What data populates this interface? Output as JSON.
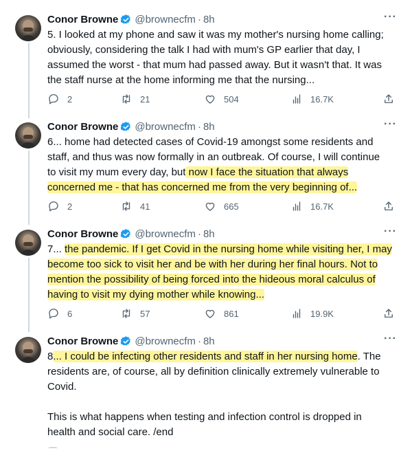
{
  "colors": {
    "text": "#0f1419",
    "secondary": "#536471",
    "verified": "#1d9bf0",
    "highlight": "#fff59a",
    "thread_line": "#cfd9de"
  },
  "icons": {
    "reply": "speech-bubble",
    "retweet": "loop-arrows",
    "like": "heart",
    "views": "bar-chart",
    "share": "upload-arrow",
    "more": "ellipsis",
    "verified": "blue-check-badge"
  },
  "tweets": [
    {
      "author": "Conor Browne",
      "handle": "@brownecfm",
      "separator": "·",
      "time": "8h",
      "more": "···",
      "text_lines": [
        "5. I looked at my phone and saw it was my mother's nursing home calling;",
        "obviously, considering the talk I had with mum's GP earlier that day, I",
        "assumed the worst - that mum had passed away. But it wasn't that. It was",
        "the staff nurse at the home informing me that the nursing..."
      ],
      "replies": "2",
      "retweets": "21",
      "likes": "504",
      "views": "16.7K"
    },
    {
      "author": "Conor Browne",
      "handle": "@brownecfm",
      "separator": "·",
      "time": "8h",
      "more": "···",
      "text_plain_1": "6... home had detected cases of Covid-19 amongst some residents and",
      "text_plain_2": "staff, and thus was now formally in an outbreak. Of course, I will continue",
      "text_plain_3": "to visit my mum every day, but",
      "text_hl_3": " now I face the situation that always",
      "text_hl_4": "concerned me - that has concerned me from the very beginning of...",
      "replies": "2",
      "retweets": "41",
      "likes": "665",
      "views": "16.7K"
    },
    {
      "author": "Conor Browne",
      "handle": "@brownecfm",
      "separator": "·",
      "time": "8h",
      "more": "···",
      "text_plain_1": "7... ",
      "text_hl_1": "the pandemic. If I get Covid in the nursing home while visiting her, I may",
      "text_hl_2": "become too sick to visit her and be with her during her final hours. Not to",
      "text_hl_3": "mention the possibility of being forced into the hideous moral calculus of",
      "text_hl_4": "having to visit my dying mother while knowing...",
      "replies": "6",
      "retweets": "57",
      "likes": "861",
      "views": "19.9K"
    },
    {
      "author": "Conor Browne",
      "handle": "@brownecfm",
      "separator": "·",
      "time": "8h",
      "more": "···",
      "text_plain_1": "8",
      "text_hl_1": "... I could be infecting other residents and staff in her nursing home",
      "text_plain_1b": ". The",
      "text_plain_2": "residents are, of course, all by definition clinically extremely vulnerable to",
      "text_plain_3": "Covid.",
      "text_para_2_1": "This is what happens when testing and infection control is dropped in",
      "text_para_2_2": "health and social care. /end"
    }
  ]
}
